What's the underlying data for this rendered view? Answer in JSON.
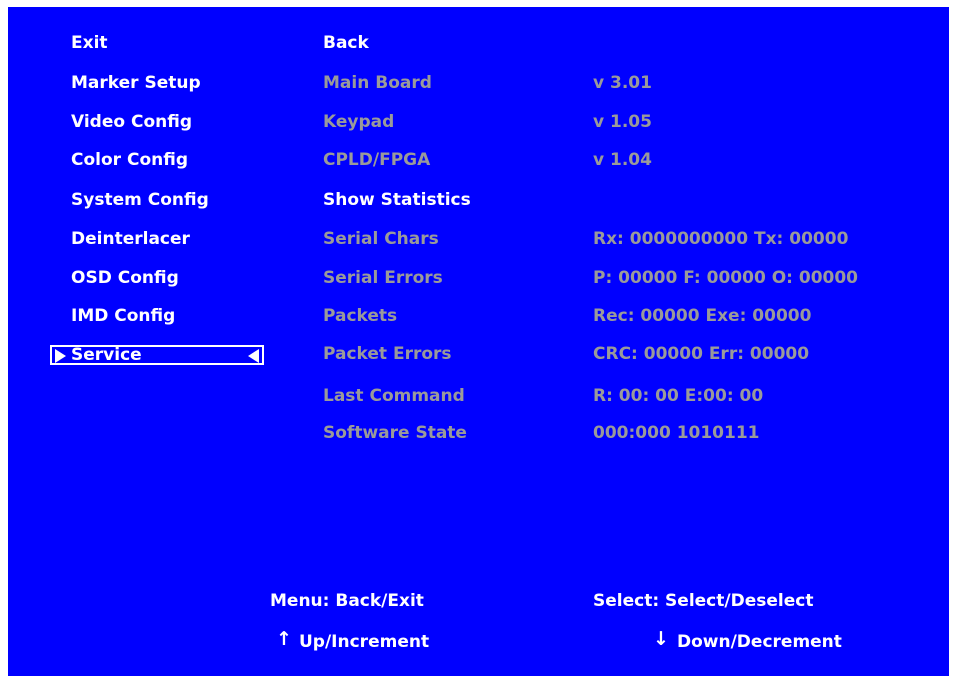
{
  "left_menu": [
    "Exit",
    "Marker Setup",
    "Video Config",
    "Color Config",
    "System Config",
    "Deinterlacer",
    "OSD Config",
    "IMD Config",
    "Service"
  ],
  "service": {
    "back": "Back",
    "rows": [
      {
        "label": "Main Board",
        "value": "v 3.01"
      },
      {
        "label": "Keypad",
        "value": "v 1.05"
      },
      {
        "label": "CPLD/FPGA",
        "value": "v 1.04"
      },
      {
        "label": "Show Statistics",
        "value": ""
      },
      {
        "label": "Serial Chars",
        "value": "Rx: 0000000000 Tx: 00000"
      },
      {
        "label": "Serial Errors",
        "value": "P: 00000 F: 00000 O: 00000"
      },
      {
        "label": "Packets",
        "value": "Rec: 00000 Exe: 00000"
      },
      {
        "label": "Packet Errors",
        "value": "CRC: 00000 Err: 00000"
      },
      {
        "label": "Last Command",
        "value": "R: 00: 00 E:00: 00"
      },
      {
        "label": "Software State",
        "value": "000:000 1010111"
      }
    ]
  },
  "footer": {
    "menu_hint": "Menu: Back/Exit",
    "select_hint": "Select: Select/Deselect",
    "up_hint": "Up/Increment",
    "down_hint": "Down/Decrement"
  },
  "icons": {
    "up": "up-arrow-icon",
    "down": "down-arrow-icon",
    "selector": "triangle-pointer-icon"
  },
  "colors": {
    "background": "#0000ff",
    "active_text": "#ffffff",
    "inactive_text": "#9a9a9a"
  }
}
